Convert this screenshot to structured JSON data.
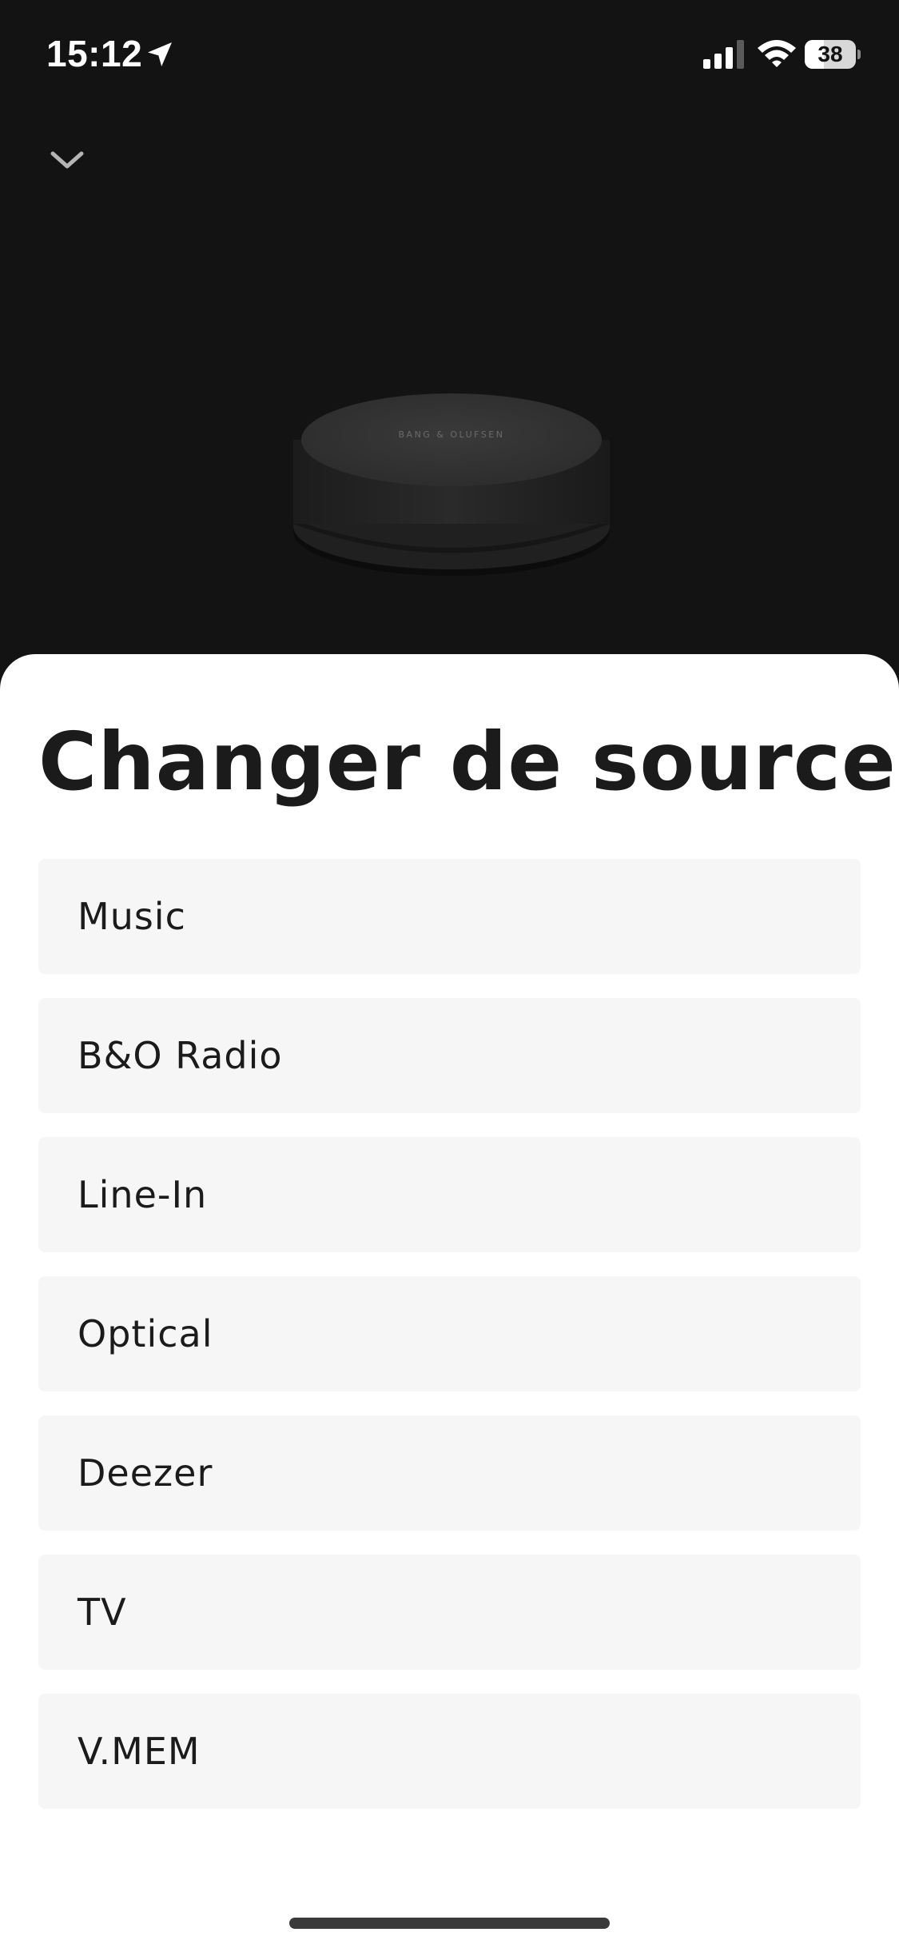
{
  "status_bar": {
    "time": "15:12",
    "battery_level": "38",
    "battery_fraction": 0.38,
    "icons": [
      "location-arrow-icon",
      "cellular-signal-icon",
      "wifi-icon",
      "battery-icon"
    ]
  },
  "header": {
    "collapse_icon": "chevron-down-icon"
  },
  "product": {
    "brand_text": "BANG & OLUFSEN"
  },
  "sheet": {
    "title": "Changer de source",
    "sources": [
      {
        "label": "Music"
      },
      {
        "label": "B&O Radio"
      },
      {
        "label": "Line-In"
      },
      {
        "label": "Optical"
      },
      {
        "label": "Deezer"
      },
      {
        "label": "TV"
      },
      {
        "label": "V.MEM"
      }
    ]
  },
  "colors": {
    "background_dark": "#131313",
    "sheet_background": "#ffffff",
    "item_background": "#f6f6f6",
    "text_primary": "#1b1b1b"
  }
}
